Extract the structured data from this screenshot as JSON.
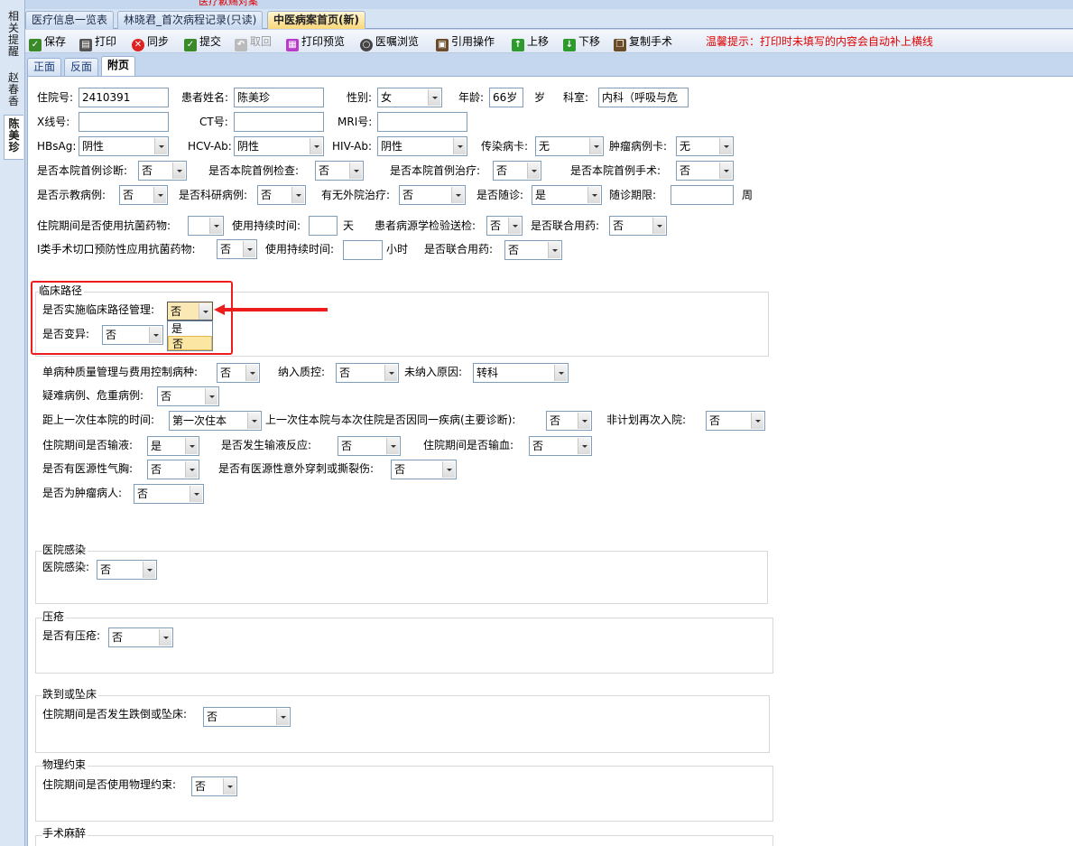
{
  "top_red_text": "医疗歉赐对案",
  "left_tabs": [
    "相关提醒",
    "赵春香",
    "陈美珍"
  ],
  "doc_tabs": [
    "医疗信息一览表",
    "林晓君_首次病程记录(只读)",
    "中医病案首页(新)"
  ],
  "toolbar": {
    "save": "保存",
    "print": "打印",
    "sync": "同步",
    "submit": "提交",
    "withdraw": "取回",
    "print_preview": "打印预览",
    "order_browse": "医嘱浏览",
    "cite": "引用操作",
    "move_up": "上移",
    "move_down": "下移",
    "copy_surgery": "复制手术",
    "tip": "温馨提示：打印时未填写的内容会自动补上横线"
  },
  "page_tabs": [
    "正面",
    "反面",
    "附页"
  ],
  "form": {
    "admission_no_label": "住院号:",
    "admission_no": "2410391",
    "patient_name_label": "患者姓名:",
    "patient_name": "陈美珍",
    "sex_label": "性别:",
    "sex": "女",
    "age_label": "年龄:",
    "age": "66岁",
    "age_unit": "岁",
    "dept_label": "科室:",
    "dept": "内科（呼吸与危",
    "xray_label": "X线号:",
    "ct_label": "CT号:",
    "mri_label": "MRI号:",
    "hbsag_label": "HBsAg:",
    "hbsag": "阴性",
    "hcv_label": "HCV-Ab:",
    "hcv": "阴性",
    "hiv_label": "HIV-Ab:",
    "hiv": "阴性",
    "infect_card_label": "传染病卡:",
    "infect_card": "无",
    "tumor_card_label": "肿瘤病例卡:",
    "tumor_card": "无",
    "first_diag_label": "是否本院首例诊断:",
    "first_diag": "否",
    "first_exam_label": "是否本院首例检查:",
    "first_exam": "否",
    "first_treat_label": "是否本院首例治疗:",
    "first_treat": "否",
    "first_surg_label": "是否本院首例手术:",
    "first_surg": "否",
    "teach_label": "是否示教病例:",
    "teach": "否",
    "research_label": "是否科研病例:",
    "research": "否",
    "outside_label": "有无外院治疗:",
    "outside": "否",
    "followup_label": "是否随诊:",
    "followup": "是",
    "followup_period_label": "随诊期限:",
    "followup_unit": "周",
    "antibiotic_label": "住院期间是否使用抗菌药物:",
    "antibiotic": "",
    "duration_label": "使用持续时间:",
    "duration_unit_day": "天",
    "pathogen_label": "患者病源学检验送检:",
    "pathogen": "否",
    "combined_label": "是否联合用药:",
    "combined": "否",
    "class1_label": "I类手术切口预防性应用抗菌药物:",
    "class1": "否",
    "duration2_label": "使用持续时间:",
    "duration_unit_hour": "小时",
    "combined2_label": "是否联合用药:",
    "combined2": "否"
  },
  "pathway": {
    "title": "临床路径",
    "implement_label": "是否实施临床路径管理:",
    "implement": "否",
    "variant_label": "是否变异:",
    "variant": "否",
    "options": [
      "是",
      "否"
    ]
  },
  "quality": {
    "single_label": "单病种质量管理与费用控制病种:",
    "single": "否",
    "included_label": "纳入质控:",
    "included": "否",
    "reason_label": "未纳入原因:",
    "reason": "转科",
    "difficult_label": "疑难病例、危重病例:",
    "difficult": "否",
    "last_time_label": "距上一次住本院的时间:",
    "last_time": "第一次住本",
    "same_disease_label": "上一次住本院与本次住院是否因同一疾病(主要诊断):",
    "same_disease": "否",
    "unplanned_label": "非计划再次入院:",
    "unplanned": "否",
    "infusion_label": "住院期间是否输液:",
    "infusion": "是",
    "reaction_label": "是否发生输液反应:",
    "reaction": "否",
    "transfusion_label": "住院期间是否输血:",
    "transfusion": "否",
    "pneumo_label": "是否有医源性气胸:",
    "pneumo": "否",
    "puncture_label": "是否有医源性意外穿刺或撕裂伤:",
    "puncture": "否",
    "tumor_label": "是否为肿瘤病人:",
    "tumor": "否"
  },
  "infection": {
    "title": "医院感染",
    "label": "医院感染:",
    "value": "否"
  },
  "pressure": {
    "title": "压疮",
    "label": "是否有压疮:",
    "value": "否"
  },
  "fall": {
    "title": "跌到或坠床",
    "label": "住院期间是否发生跌倒或坠床:",
    "value": "否"
  },
  "restraint": {
    "title": "物理约束",
    "label": "住院期间是否使用物理约束:",
    "value": "否"
  },
  "anesthesia": {
    "title": "手术麻醉"
  },
  "colors": {
    "highlight_red": "#ee1c1c",
    "tip_red": "#e00000",
    "active_tab": "#f9d77a"
  }
}
